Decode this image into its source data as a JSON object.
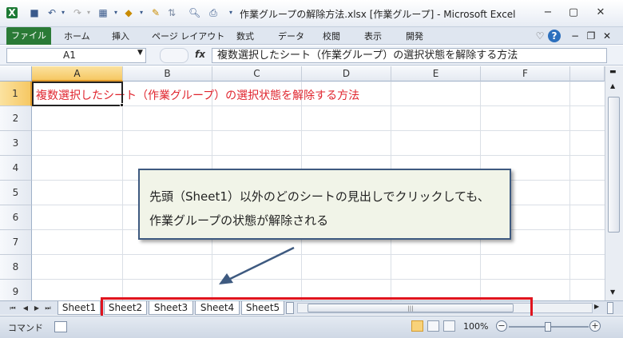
{
  "window": {
    "title": "作業グループの解除方法.xlsx  [作業グループ]  -  Microsoft Excel",
    "minimize_glyph": "−",
    "restore_glyph": "▢",
    "close_glyph": "✕"
  },
  "qat": {
    "excel_icon": "X",
    "save_glyph": "💾",
    "undo_glyph": "↶",
    "redo_glyph": "↷",
    "dropdown_glyph": "▾"
  },
  "ribbon": {
    "file_tab": "ファイル",
    "tabs": [
      "ホーム",
      "挿入",
      "ページ レイアウト",
      "数式",
      "データ",
      "校閲",
      "表示",
      "開発"
    ],
    "help_glyph": "?"
  },
  "formula_bar": {
    "name_box": "A1",
    "fx_label": "fx",
    "formula": "複数選択したシート（作業グループ）の選択状態を解除する方法"
  },
  "grid": {
    "columns": [
      "A",
      "B",
      "C",
      "D",
      "E",
      "F"
    ],
    "rows": [
      "1",
      "2",
      "3",
      "4",
      "5",
      "6",
      "7",
      "8",
      "9"
    ],
    "selected_column": "A",
    "selected_row": "1",
    "cell_a1": "複数選択したシート（作業グループ）の選択状態を解除する方法",
    "cell_a1_color": "#e0262f"
  },
  "callout": {
    "line1": "先頭（Sheet1）以外のどのシートの見出しでクリックしても、",
    "line2": "作業グループの状態が解除される",
    "border_color": "#3e5a80",
    "fill_color": "#f1f4e8"
  },
  "sheet_tabs": {
    "nav": [
      "⏮",
      "◀",
      "▶",
      "⏭"
    ],
    "tabs": [
      "Sheet1",
      "Sheet2",
      "Sheet3",
      "Sheet4",
      "Sheet5"
    ],
    "grouped": [
      "Sheet1",
      "Sheet2",
      "Sheet3",
      "Sheet4",
      "Sheet5"
    ]
  },
  "highlight": {
    "color": "#e0141e"
  },
  "status_bar": {
    "mode": "コマンド",
    "zoom": "100%",
    "zoom_out": "−",
    "zoom_in": "+"
  }
}
